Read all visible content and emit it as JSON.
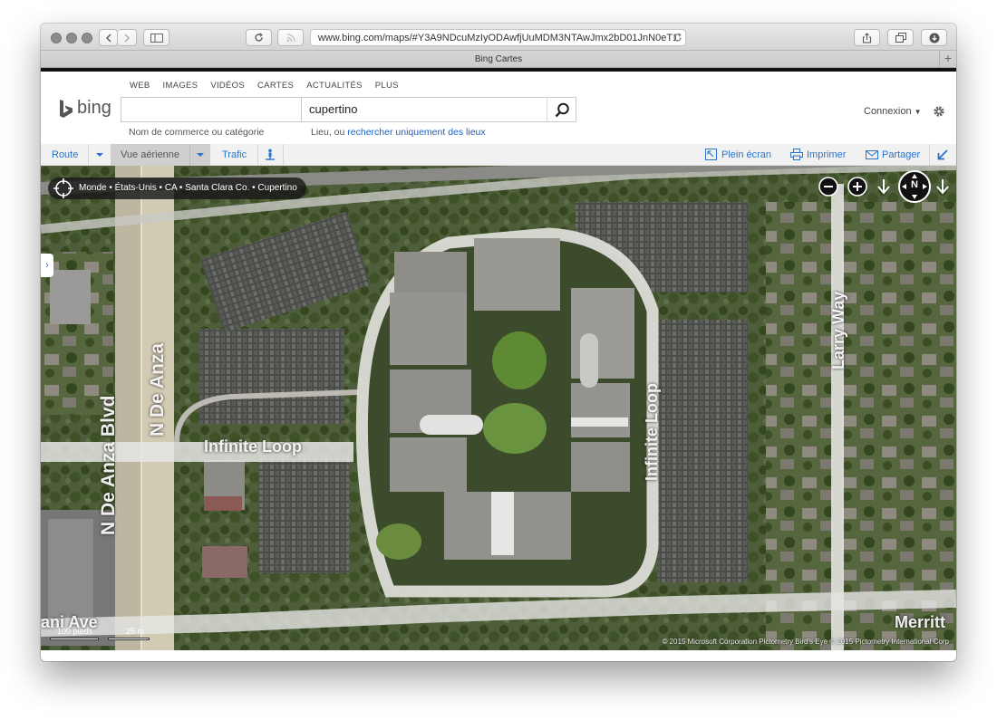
{
  "browser": {
    "url": "www.bing.com/maps/#Y3A9NDcuMzIyODAwfjUuMDM3NTAwJmx2bD01JnN0eT1",
    "tab_title": "Bing Cartes"
  },
  "bing": {
    "logo_text": "bing",
    "nav": [
      "WEB",
      "IMAGES",
      "VIDÉOS",
      "CARTES",
      "ACTUALITÉS",
      "PLUS"
    ],
    "business_input_value": "",
    "place_input_value": "cupertino",
    "business_hint": "Nom de commerce ou catégorie",
    "place_hint_prefix": "Lieu, ou ",
    "place_hint_link": "rechercher uniquement des lieux",
    "signin": "Connexion"
  },
  "maptools": {
    "route": "Route",
    "view": "Vue aérienne",
    "traffic": "Trafic",
    "fullscreen": "Plein écran",
    "print": "Imprimer",
    "share": "Partager"
  },
  "map": {
    "breadcrumb": "Monde • États-Unis • CA • Santa Clara Co. • Cupertino",
    "compass": "N",
    "streets": {
      "de_anza_blvd": "N De Anza Blvd",
      "de_anza": "N De Anza",
      "infinite_loop_h": "Infinite Loop",
      "infinite_loop_v": "Infinite Loop",
      "larry_way": "Larry Way",
      "ave": "ani Ave",
      "merritt": "Merritt"
    },
    "scale_imperial": "100 pieds",
    "scale_metric": "25 m",
    "copyright": "© 2015 Microsoft Corporation     Pictometry Bird's Eye © 2015 Pictometry International Corp"
  },
  "colors": {
    "accent": "#2b73c9",
    "link": "#1a60c7"
  }
}
